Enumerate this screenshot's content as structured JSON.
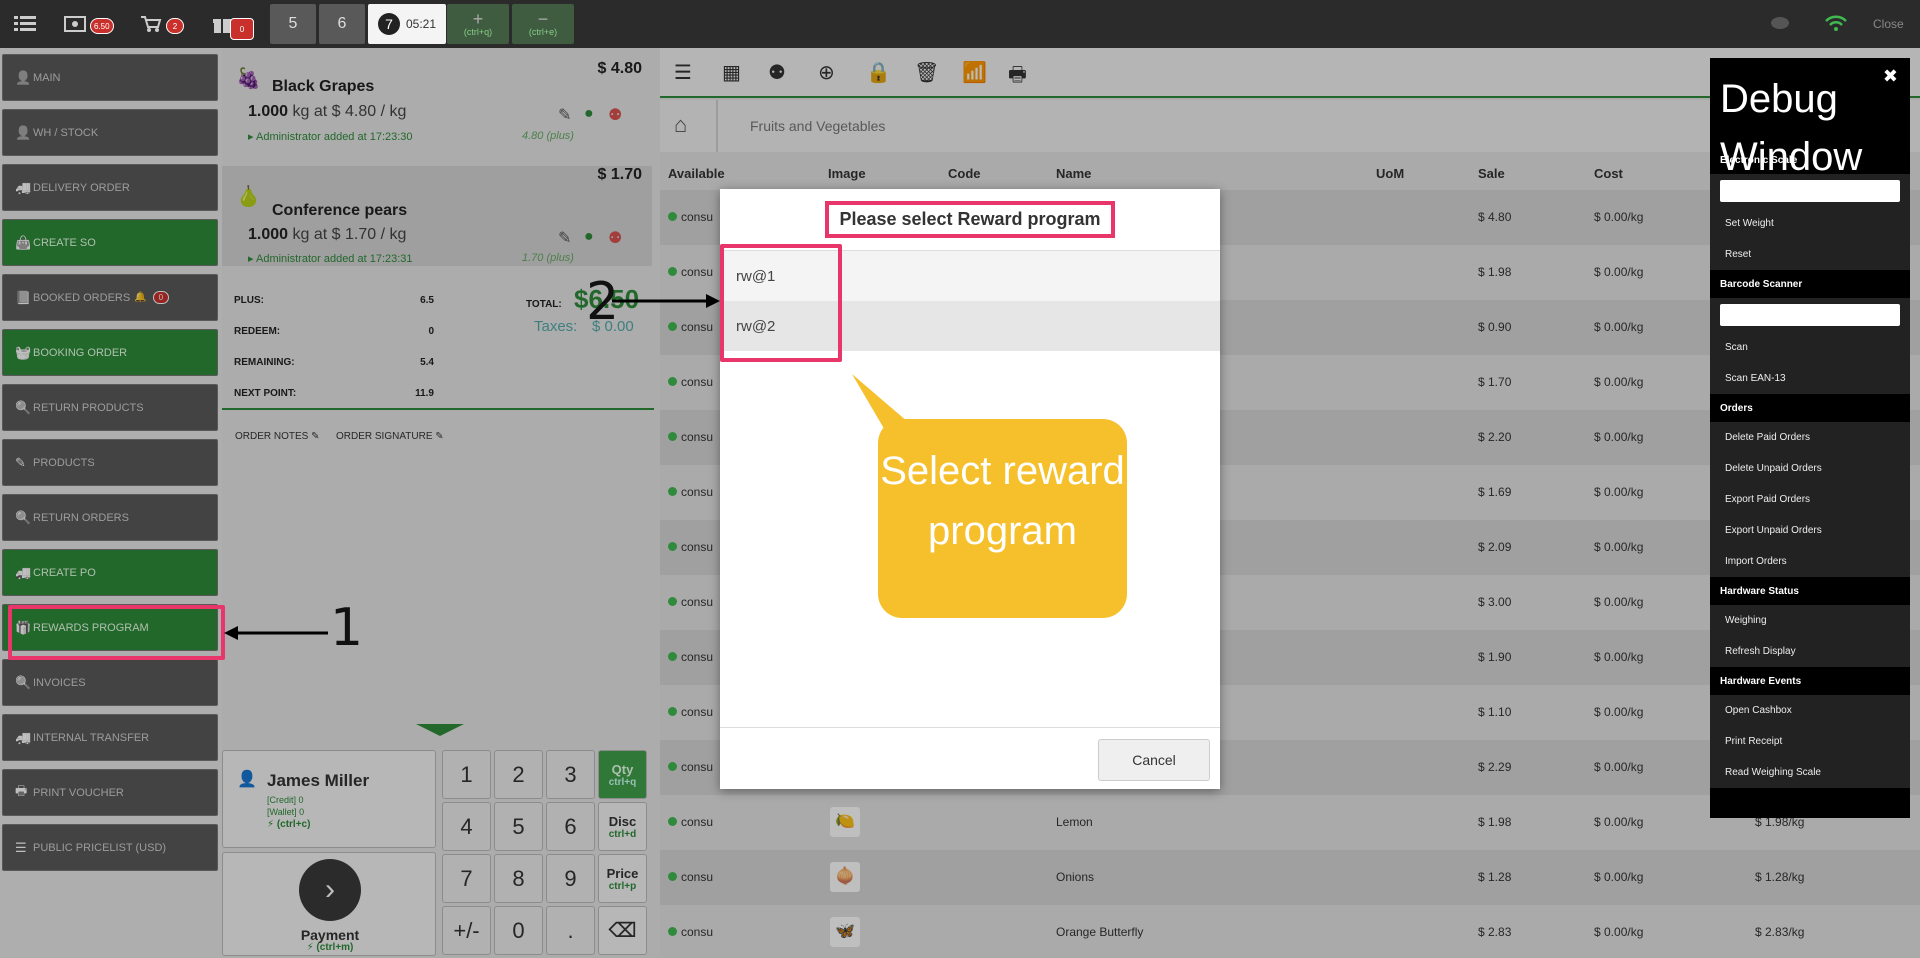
{
  "topbar": {
    "cash_badge": "6.50",
    "cart_badge": "2",
    "gift_badge": "0",
    "tabs": [
      "5",
      "6"
    ],
    "active_tab": {
      "number": "7",
      "time": "05:21"
    },
    "add_order_shortcut": "(ctrl+q)",
    "remove_order_shortcut": "(ctrl+e)",
    "close_label": "Close"
  },
  "menu": {
    "items": [
      {
        "label": "MAIN",
        "icon": "user-icon",
        "style": "gray"
      },
      {
        "label": "WH / STOCK",
        "icon": "user-icon",
        "style": "gray"
      },
      {
        "label": "DELIVERY ORDER",
        "icon": "truck-icon",
        "style": "gray"
      },
      {
        "label": "CREATE SO",
        "icon": "bag-icon",
        "style": "green"
      },
      {
        "label": "BOOKED ORDERS",
        "icon": "book-icon",
        "style": "gray",
        "badge": "0"
      },
      {
        "label": "BOOKING ORDER",
        "icon": "basket-icon",
        "style": "green"
      },
      {
        "label": "RETURN PRODUCTS",
        "icon": "search-icon",
        "style": "gray"
      },
      {
        "label": "PRODUCTS",
        "icon": "edit-icon",
        "style": "gray"
      },
      {
        "label": "RETURN ORDERS",
        "icon": "search-icon",
        "style": "gray"
      },
      {
        "label": "CREATE PO",
        "icon": "truck-icon",
        "style": "green"
      },
      {
        "label": "REWARDS PROGRAM",
        "icon": "gift-icon",
        "style": "green"
      },
      {
        "label": "INVOICES",
        "icon": "search-icon",
        "style": "gray"
      },
      {
        "label": "INTERNAL TRANSFER",
        "icon": "truck-icon",
        "style": "gray"
      },
      {
        "label": "PRINT VOUCHER",
        "icon": "print-icon",
        "style": "gray"
      },
      {
        "label": "PUBLIC PRICELIST (USD)",
        "icon": "list-icon",
        "style": "gray"
      }
    ]
  },
  "order": {
    "lines": [
      {
        "name": "Black Grapes",
        "price": "$ 4.80",
        "qty": "1.000",
        "unit_text": "kg at $ 4.80 / kg",
        "added": "Administrator added at 17:23:30",
        "plus": "4.80 (plus)"
      },
      {
        "name": "Conference pears",
        "price": "$ 1.70",
        "qty": "1.000",
        "unit_text": "kg at $ 1.70 / kg",
        "added": "Administrator added at 17:23:31",
        "plus": "1.70 (plus)"
      }
    ],
    "summary": [
      {
        "label": "PLUS:",
        "value": "6.5"
      },
      {
        "label": "REDEEM:",
        "value": "0"
      },
      {
        "label": "REMAINING:",
        "value": "5.4"
      },
      {
        "label": "NEXT POINT:",
        "value": "11.9"
      }
    ],
    "total_label": "TOTAL:",
    "total_value": "$6.50",
    "taxes_label": "Taxes:",
    "taxes_value": "$ 0.00",
    "notes_label": "ORDER NOTES",
    "signature_label": "ORDER SIGNATURE",
    "customer": {
      "name": "James Miller",
      "credit": "[Credit] 0",
      "wallet": "[Wallet] 0",
      "shortcut": "(ctrl+c)"
    },
    "payment_label": "Payment",
    "payment_shortcut": "(ctrl+m)"
  },
  "numpad": {
    "keys": [
      "1",
      "2",
      "3",
      "4",
      "5",
      "6",
      "7",
      "8",
      "9",
      "+/-",
      "0",
      "."
    ],
    "qty": {
      "label": "Qty",
      "shortcut": "ctrl+q"
    },
    "disc": {
      "label": "Disc",
      "shortcut": "ctrl+d"
    },
    "price": {
      "label": "Price",
      "shortcut": "ctrl+p"
    }
  },
  "breadcrumb": {
    "category": "Fruits and Vegetables"
  },
  "table": {
    "headers": [
      "Available",
      "Image",
      "Code",
      "Name",
      "UoM",
      "Sale",
      "Cost"
    ],
    "rows": [
      {
        "available": "consu",
        "name": "",
        "sale": "$ 4.80",
        "cost": "$ 0.00/kg",
        "list": ""
      },
      {
        "available": "consu",
        "name": "",
        "sale": "$ 1.98",
        "cost": "$ 0.00/kg",
        "list": ""
      },
      {
        "available": "consu",
        "name": "",
        "sale": "$ 0.90",
        "cost": "$ 0.00/kg",
        "list": ""
      },
      {
        "available": "consu",
        "name": "",
        "sale": "$ 1.70",
        "cost": "$ 0.00/kg",
        "list": ""
      },
      {
        "available": "consu",
        "name": "",
        "sale": "$ 2.20",
        "cost": "$ 0.00/kg",
        "list": ""
      },
      {
        "available": "consu",
        "name": "",
        "sale": "$ 1.69",
        "cost": "$ 0.00/kg",
        "list": ""
      },
      {
        "available": "consu",
        "name": "",
        "sale": "$ 2.09",
        "cost": "$ 0.00/kg",
        "list": ""
      },
      {
        "available": "consu",
        "name": "",
        "sale": "$ 3.00",
        "cost": "$ 0.00/kg",
        "list": ""
      },
      {
        "available": "consu",
        "name": "",
        "sale": "$ 1.90",
        "cost": "$ 0.00/kg",
        "list": ""
      },
      {
        "available": "consu",
        "name": "",
        "sale": "$ 1.10",
        "cost": "$ 0.00/kg",
        "list": ""
      },
      {
        "available": "consu",
        "name": "",
        "sale": "$ 2.29",
        "cost": "$ 0.00/kg",
        "list": ""
      },
      {
        "available": "consu",
        "name": "Lemon",
        "sale": "$ 1.98",
        "cost": "$ 0.00/kg",
        "list": "$ 1.98/kg"
      },
      {
        "available": "consu",
        "name": "Onions",
        "sale": "$ 1.28",
        "cost": "$ 0.00/kg",
        "list": "$ 1.28/kg"
      },
      {
        "available": "consu",
        "name": "Orange Butterfly",
        "sale": "$ 2.83",
        "cost": "$ 0.00/kg",
        "list": "$ 2.83/kg"
      }
    ]
  },
  "dialog": {
    "title": "Please select Reward program",
    "options": [
      "rw@1",
      "rw@2"
    ],
    "cancel_label": "Cancel"
  },
  "callout": {
    "text": "Select reward program"
  },
  "annotations": {
    "step1": "1",
    "step2": "2"
  },
  "debug": {
    "title": "Debug Window",
    "sections": [
      {
        "title": "Electronic Scale",
        "input": true,
        "items": [
          "Set Weight",
          "Reset"
        ]
      },
      {
        "title": "Barcode Scanner",
        "input": true,
        "items": [
          "Scan",
          "Scan EAN-13"
        ]
      },
      {
        "title": "Orders",
        "input": false,
        "items": [
          "Delete Paid Orders",
          "Delete Unpaid Orders",
          "Export Paid Orders",
          "Export Unpaid Orders",
          "Import Orders"
        ]
      },
      {
        "title": "Hardware Status",
        "input": false,
        "items": [
          "Weighing",
          "Refresh Display"
        ]
      },
      {
        "title": "Hardware Events",
        "input": false,
        "items": [
          "Open Cashbox",
          "Print Receipt",
          "Read Weighing Scale"
        ]
      }
    ]
  },
  "colors": {
    "brand_green": "#2e8b3a",
    "highlight_pink": "#e8356a",
    "callout_yellow": "#f5c02c",
    "badge_red": "#c9302c"
  }
}
